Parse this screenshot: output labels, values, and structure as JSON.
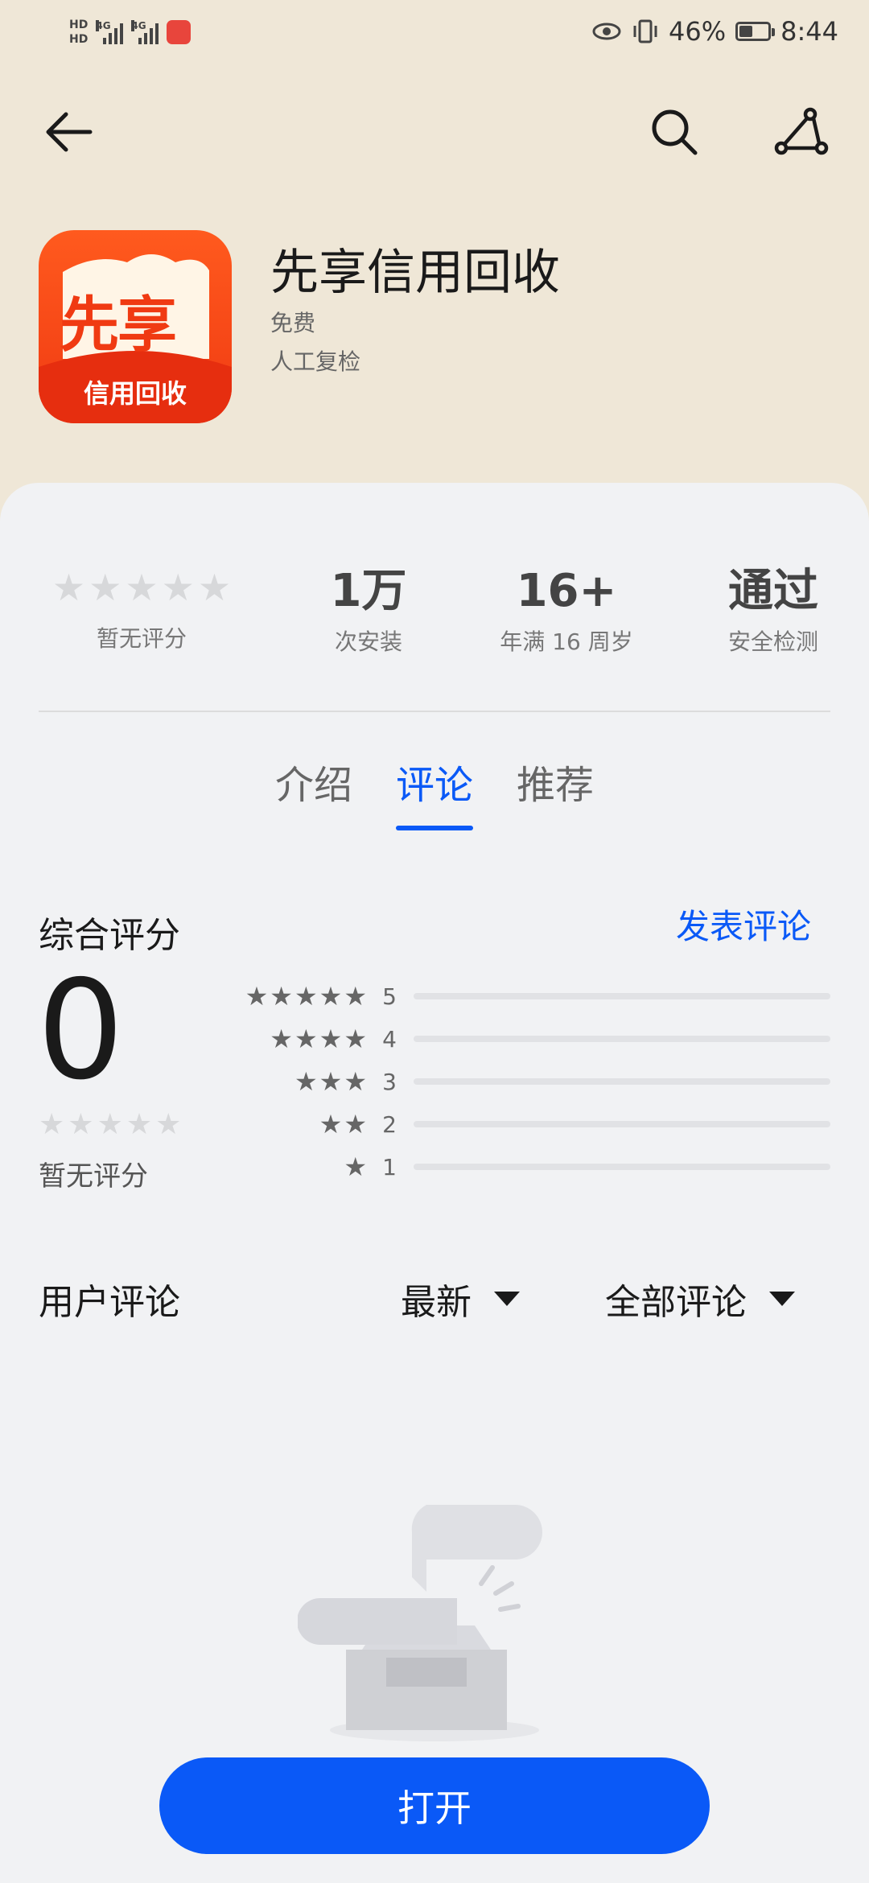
{
  "status_bar": {
    "hd1": "HD",
    "hd2": "HD",
    "net1": "4G",
    "net2": "4G",
    "battery_percent": "46%",
    "battery_level": 0.46,
    "time": "8:44"
  },
  "toolbar": {
    "back_icon": "arrow-left-icon",
    "search_icon": "search-icon",
    "share_icon": "share-icon"
  },
  "app": {
    "name": "先享信用回收",
    "price": "免费",
    "review_status": "人工复检",
    "icon_text_top": "先享",
    "icon_text_bottom": "信用回收",
    "icon_colors": {
      "primary": "#f03a12",
      "accent": "#ffffff"
    }
  },
  "stats": {
    "rating_text": "暂无评分",
    "installs": "1万",
    "installs_label": "次安装",
    "age": "16+",
    "age_label": "年满 16 周岁",
    "security": "通过",
    "security_label": "安全检测"
  },
  "tabs": [
    {
      "label": "介绍",
      "active": false
    },
    {
      "label": "评论",
      "active": true
    },
    {
      "label": "推荐",
      "active": false
    }
  ],
  "ratings": {
    "section_title": "综合评分",
    "write_review": "发表评论",
    "score": "0",
    "no_rating": "暂无评分",
    "distribution": [
      {
        "stars": "5",
        "fraction": 0
      },
      {
        "stars": "4",
        "fraction": 0
      },
      {
        "stars": "3",
        "fraction": 0
      },
      {
        "stars": "2",
        "fraction": 0
      },
      {
        "stars": "1",
        "fraction": 0
      }
    ]
  },
  "reviews": {
    "title": "用户评论",
    "sort": "最新",
    "filter": "全部评论"
  },
  "bottom": {
    "open_button": "打开"
  },
  "colors": {
    "accent": "#0a59f7",
    "header_bg": "#efe7d7",
    "card_bg": "#f1f2f4"
  }
}
